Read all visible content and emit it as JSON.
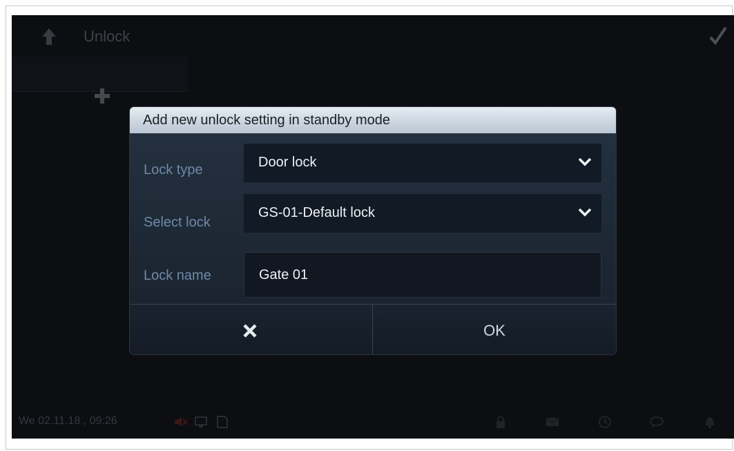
{
  "app": {
    "title": "Unlock",
    "icons": {
      "back": "back-arrow-icon",
      "confirm": "check-icon",
      "add": "plus-icon"
    }
  },
  "status_bar": {
    "datetime": "We 02.11.18 , 09:26",
    "icons": [
      "mute-icon",
      "network-icon",
      "sd-card-icon",
      "lock-icon",
      "mail-icon",
      "clock-icon",
      "chat-icon",
      "bell-icon"
    ]
  },
  "dialog": {
    "title": "Add new unlock setting in standby mode",
    "lock_type": {
      "label": "Lock type",
      "value": "Door lock"
    },
    "select_lock": {
      "label": "Select lock",
      "value": "GS-01-Default lock"
    },
    "lock_name": {
      "label": "Lock name",
      "value": "Gate 01"
    },
    "ok_label": "OK"
  },
  "colors": {
    "background": "#0d0e11",
    "dialog": "#1f2a37",
    "label": "#6f89a9",
    "header": "#c9d4df"
  }
}
